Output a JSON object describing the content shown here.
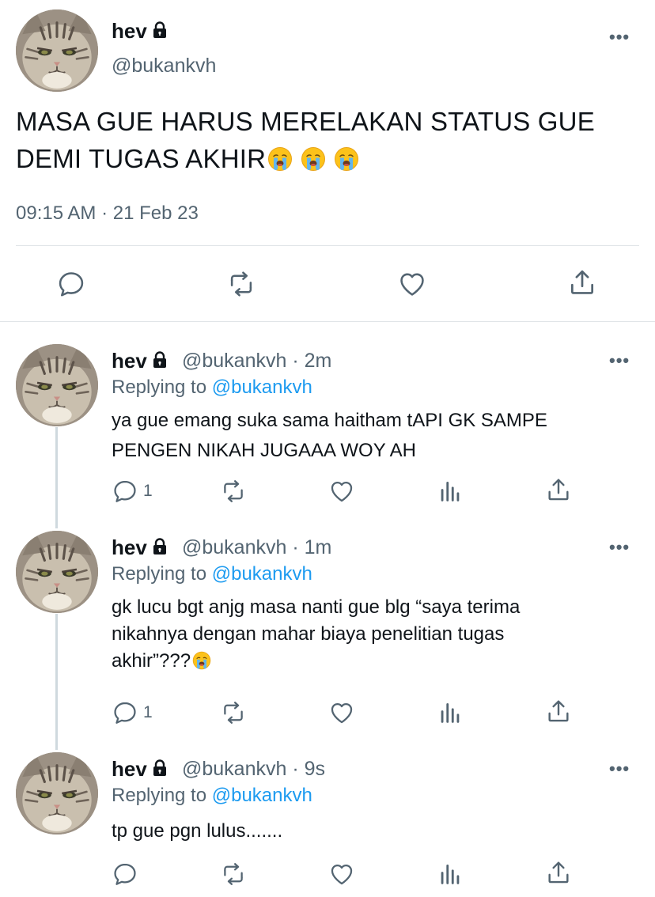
{
  "main_tweet": {
    "display_name": "hev",
    "handle": "@bukankvh",
    "text_line1": "MASA GUE HARUS MERELAKAN STATUS GUE",
    "text_line2": "DEMI TUGAS AKHIR",
    "emoji": "crying-face",
    "timestamp": "09:15 AM · 21 Feb 23",
    "more_label": "•••"
  },
  "replies": [
    {
      "display_name": "hev",
      "handle_time": "@bukankvh · 2m",
      "replying_prefix": "Replying to",
      "replying_to": "@bukankvh",
      "text_line1": "ya gue emang suka sama haitham tAPI GK SAMPE",
      "text_line2": "PENGEN NIKAH JUGAAA WOY AH",
      "reply_count": "1",
      "more_label": "•••"
    },
    {
      "display_name": "hev",
      "handle_time": "@bukankvh · 1m",
      "replying_prefix": "Replying to",
      "replying_to": "@bukankvh",
      "text_line1": "gk lucu bgt anjg masa nanti gue blg “saya terima",
      "text_line2": "nikahnya dengan mahar biaya penelitian tugas",
      "text_line3": "akhir”???",
      "reply_count": "1",
      "more_label": "•••"
    },
    {
      "display_name": "hev",
      "handle_time": "@bukankvh · 9s",
      "replying_prefix": "Replying to",
      "replying_to": "@bukankvh",
      "text_line1": "tp gue pgn lulus.......",
      "more_label": "•••"
    }
  ],
  "colors": {
    "text": "#0f1419",
    "secondary": "#536471",
    "link": "#1d9bf0",
    "divider": "#e1e5e8"
  },
  "icons": [
    "lock-icon",
    "more-icon",
    "reply-icon",
    "retweet-icon",
    "like-icon",
    "share-icon",
    "analytics-icon"
  ]
}
